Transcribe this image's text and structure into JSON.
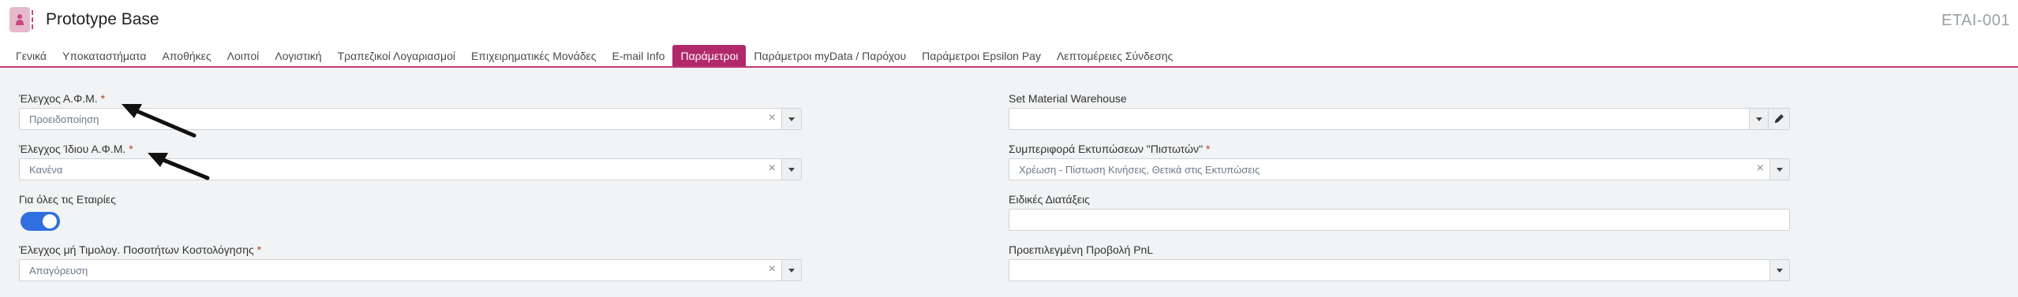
{
  "app": {
    "title": "Prototype Base",
    "code": "ETAI-001"
  },
  "tabs": [
    {
      "label": "Γενικά",
      "active": false
    },
    {
      "label": "Υποκαταστήματα",
      "active": false
    },
    {
      "label": "Αποθήκες",
      "active": false
    },
    {
      "label": "Λοιποί",
      "active": false
    },
    {
      "label": "Λογιστική",
      "active": false
    },
    {
      "label": "Τραπεζικοί Λογαριασμοί",
      "active": false
    },
    {
      "label": "Επιχειρηματικές Μονάδες",
      "active": false
    },
    {
      "label": "E-mail Info",
      "active": false
    },
    {
      "label": "Παράμετροι",
      "active": true
    },
    {
      "label": "Παράμετροι myData / Παρόχου",
      "active": false
    },
    {
      "label": "Παράμετροι Epsilon Pay",
      "active": false
    },
    {
      "label": "Λεπτομέρειες Σύνδεσης",
      "active": false
    }
  ],
  "left": {
    "vat_check": {
      "label": "Έλεγχος Α.Φ.Μ.",
      "required": "*",
      "value": "Προειδοποίηση"
    },
    "own_vat_check": {
      "label": "Έλεγχος Ίδιου Α.Φ.Μ.",
      "required": "*",
      "value": "Κανένα"
    },
    "all_companies": {
      "label": "Για όλες τις Εταιρίες",
      "enabled": true
    },
    "cost_qty_check": {
      "label": "Έλεγχος μή Τιμολογ. Ποσοτήτων Κοστολόγησης",
      "required": "*",
      "value": "Απαγόρευση"
    }
  },
  "right": {
    "material_warehouse": {
      "label": "Set Material Warehouse",
      "value": ""
    },
    "credit_print_behavior": {
      "label": "Συμπεριφορά Εκτυπώσεων \"Πιστωτών\"",
      "required": "*",
      "value": "Χρέωση - Πίστωση Κινήσεις, Θετικά στις Εκτυπώσεις"
    },
    "special_provisions": {
      "label": "Ειδικές Διατάξεις",
      "value": ""
    },
    "default_pnl_view": {
      "label": "Προεπιλεγμένη Προβολή PnL",
      "value": ""
    }
  },
  "icons": {
    "app": "person-icon",
    "clear": "clear-icon",
    "dropdown": "chevron-down-icon",
    "edit": "pencil-icon",
    "annotation": "arrow-icon"
  },
  "colors": {
    "accent": "#b2296b",
    "toggle": "#2f6fe0"
  }
}
